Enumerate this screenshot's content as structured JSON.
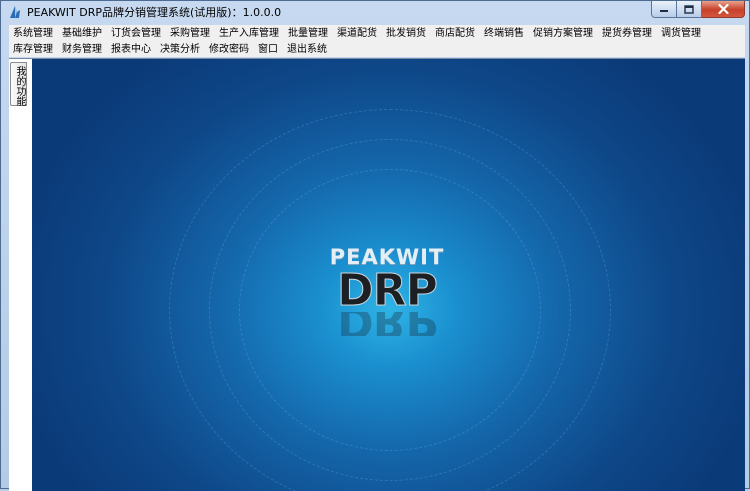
{
  "window": {
    "title": "PEAKWIT DRP品牌分销管理系统(试用版)：1.0.0.0",
    "icon": "app-logo-icon"
  },
  "menubar": {
    "row1": [
      "系统管理",
      "基础维护",
      "订货会管理",
      "采购管理",
      "生产入库管理",
      "批量管理",
      "渠道配货",
      "批发销货",
      "商店配货",
      "终端销售",
      "促销方案管理",
      "提货券管理",
      "调货管理"
    ],
    "row2": [
      "库存管理",
      "财务管理",
      "报表中心",
      "决策分析",
      "修改密码",
      "窗口",
      "退出系统"
    ]
  },
  "sidebar": {
    "tab_label": "我的功能"
  },
  "splash": {
    "logo_top": "PEAKWIT",
    "logo_main": "DRP"
  },
  "colors": {
    "accent": "#1a8fcf",
    "close_button": "#c7402a"
  }
}
